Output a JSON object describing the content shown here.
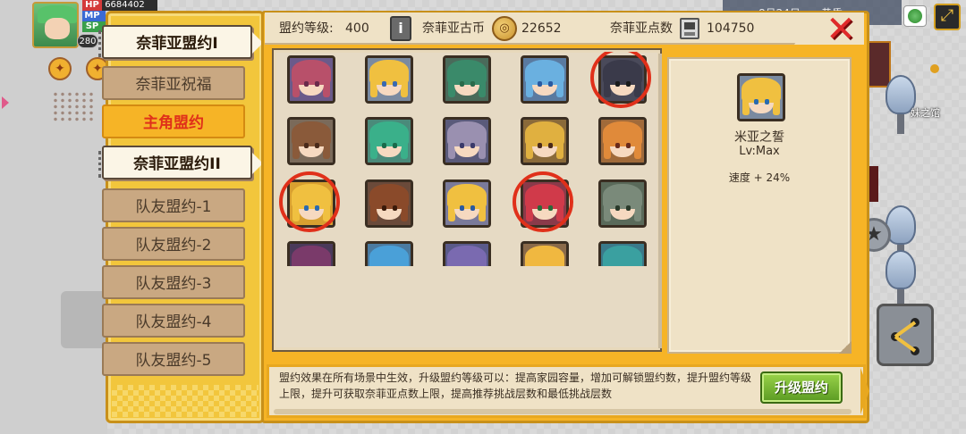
{
  "player": {
    "hp_label": "HP",
    "hp_value": "6684402",
    "mp_label": "MP",
    "sp_label": "SP",
    "level": "280"
  },
  "tabs": [
    {
      "label": "奈菲亚盟约I",
      "kind": "header"
    },
    {
      "label": "奈菲亚祝福",
      "kind": "inactive"
    },
    {
      "label": "主角盟约",
      "kind": "active"
    },
    {
      "label": "奈菲亚盟约II",
      "kind": "header"
    },
    {
      "label": "队友盟约-1",
      "kind": "inactive"
    },
    {
      "label": "队友盟约-2",
      "kind": "inactive"
    },
    {
      "label": "队友盟约-3",
      "kind": "inactive"
    },
    {
      "label": "队友盟约-4",
      "kind": "inactive"
    },
    {
      "label": "队友盟约-5",
      "kind": "inactive"
    }
  ],
  "topbar": {
    "level_label": "盟约等级:",
    "level_value": "400",
    "coin_label": "奈菲亚古币",
    "coin_value": "22652",
    "points_label": "奈菲亚点数",
    "points_value": "104750"
  },
  "portraits": [
    {
      "hair": "#b8506a",
      "bg": "#6a5a8a",
      "eyes": "#6a2a4a",
      "circled": false
    },
    {
      "hair": "#f0c040",
      "bg": "#7a8aa0",
      "eyes": "#3a6ab0",
      "circled": false
    },
    {
      "hair": "#3a8a6a",
      "bg": "#4a6a5a",
      "eyes": "#2a6a4a",
      "circled": false
    },
    {
      "hair": "#6ab0e0",
      "bg": "#5a7aa0",
      "eyes": "#2a5aa0",
      "circled": false
    },
    {
      "hair": "#3a3a4a",
      "bg": "#4a4a5a",
      "eyes": "#1a1a1a",
      "circled": true
    },
    {
      "hair": "#8a5a3a",
      "bg": "#7a6a5a",
      "eyes": "#4a2a1a",
      "circled": false
    },
    {
      "hair": "#3ab08a",
      "bg": "#4a8a7a",
      "eyes": "#1a6a4a",
      "circled": false
    },
    {
      "hair": "#9a90b0",
      "bg": "#5a5a7a",
      "eyes": "#3a3a6a",
      "circled": false
    },
    {
      "hair": "#e0b040",
      "bg": "#8a6a3a",
      "eyes": "#4a2a1a",
      "circled": false
    },
    {
      "hair": "#e08a3a",
      "bg": "#a06a3a",
      "eyes": "#6a2a1a",
      "circled": false
    },
    {
      "hair": "#f0c040",
      "bg": "#d8a030",
      "eyes": "#2a6ab0",
      "circled": true
    },
    {
      "hair": "#8a4a2a",
      "bg": "#6a4a3a",
      "eyes": "#3a1a0a",
      "circled": false
    },
    {
      "hair": "#f0c040",
      "bg": "#7a7a9a",
      "eyes": "#2a5aa0",
      "circled": false
    },
    {
      "hair": "#d03a4a",
      "bg": "#8a3a4a",
      "eyes": "#2a6a3a",
      "circled": true
    },
    {
      "hair": "#7a8a7a",
      "bg": "#5a6a5a",
      "eyes": "#2a3a2a",
      "circled": false
    },
    {
      "hair": "#7a3a6a",
      "bg": "#4a3a5a",
      "eyes": "#6a2a5a",
      "circled": false
    },
    {
      "hair": "#4aa0d8",
      "bg": "#4a7aa0",
      "eyes": "#1a4a8a",
      "circled": false
    },
    {
      "hair": "#7a6ab0",
      "bg": "#5a5a8a",
      "eyes": "#3a3a8a",
      "circled": false
    },
    {
      "hair": "#f0b840",
      "bg": "#8a6a4a",
      "eyes": "#5a3a1a",
      "circled": false
    },
    {
      "hair": "#3aa0a0",
      "bg": "#3a7a8a",
      "eyes": "#1a5a6a",
      "circled": false
    },
    {
      "hair": "#c8c8c8",
      "bg": "#5a5a5a",
      "eyes": "#1a1a1a",
      "circled": true
    },
    {
      "hair": "#2a2a2a",
      "bg": "#3a3a3a",
      "eyes": "#e02a2a",
      "circled": false
    },
    {
      "hair": "#b02a2a",
      "bg": "#6a2a2a",
      "eyes": "#3a1a0a",
      "circled": false
    },
    {
      "hair": "#3a9a4a",
      "bg": "#4a6a4a",
      "eyes": "#1a4a2a",
      "circled": false
    },
    {
      "hair": "#2a2a3a",
      "bg": "#5a3a5a",
      "eyes": "#a02a4a",
      "circled": false
    }
  ],
  "detail": {
    "name": "米亚之誓",
    "level": "Lv:Max",
    "effect": "速度 + 24%",
    "portrait": {
      "hair": "#f0c040",
      "bg": "#7a8aa0",
      "eyes": "#2a6ab0"
    }
  },
  "description": "盟约效果在所有场景中生效，升级盟约等级可以：提高家园容量，增加可解锁盟约数，提升盟约等级上限，提升可获取奈菲亚点数上限，提高推荐挑战层数和最低挑战层数",
  "upgrade_label": "升级盟约",
  "background": {
    "location_label": "妹之馆",
    "topright_a": "8月24日",
    "topright_b": "黄昏"
  },
  "colors": {
    "accent_gold": "#f6b426",
    "panel_cream": "#efe2c6",
    "active_tab_text": "#e0301a",
    "mark_red": "#e0301a",
    "upgrade_green": "#5a9a22"
  }
}
